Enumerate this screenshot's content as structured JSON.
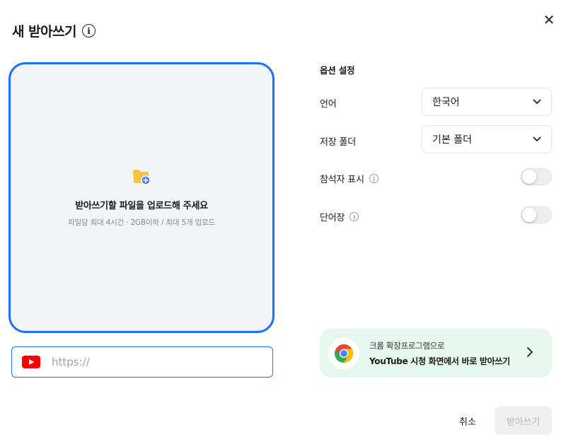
{
  "dialog": {
    "title": "새 받아쓰기",
    "info_icon": "info-icon",
    "close_icon": "close-icon",
    "close_glyph": "✕"
  },
  "dropzone": {
    "icon": "folder-plus-icon",
    "title": "받아쓰기할 파일을 업로드해 주세요",
    "subtitle": "파일당 최대 4시간 · 2GB이하 / 최대 5개 업로드"
  },
  "url_field": {
    "icon": "youtube-icon",
    "placeholder": "https://",
    "value": ""
  },
  "options": {
    "title": "옵션 설정",
    "language": {
      "label": "언어",
      "value": "한국어"
    },
    "folder": {
      "label": "저장 폴더",
      "value": "기본 폴더"
    },
    "speakers": {
      "label": "참석자 표시",
      "enabled": false
    },
    "vocabulary": {
      "label": "단어장",
      "enabled": false
    }
  },
  "promo": {
    "icon": "chrome-icon",
    "line1": "크롬 확장프로그램으로",
    "line2": "YouTube 시청 화면에서 바로 받아쓰기"
  },
  "footer": {
    "cancel_label": "취소",
    "submit_label": "받아쓰기"
  },
  "colors": {
    "accent": "#1e72ff",
    "dropzone_bg": "#f2f4f7",
    "promo_bg": "#e6f7ed",
    "youtube_red": "#ff0000"
  }
}
